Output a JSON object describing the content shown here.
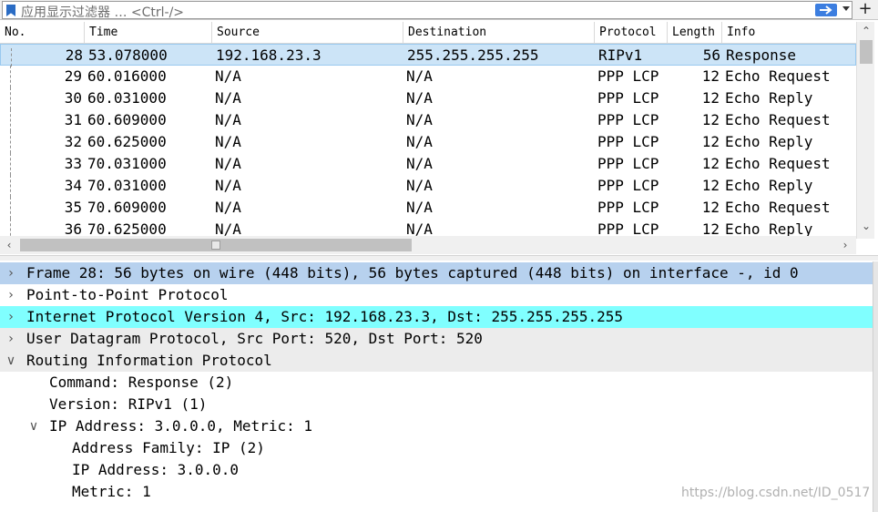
{
  "filter": {
    "placeholder": "应用显示过滤器 … <Ctrl-/>"
  },
  "columns": [
    "No.",
    "Time",
    "Source",
    "Destination",
    "Protocol",
    "Length",
    "Info"
  ],
  "packets": [
    {
      "no": "28",
      "time": "53.078000",
      "source": "192.168.23.3",
      "destination": "255.255.255.255",
      "protocol": "RIPv1",
      "length": "56",
      "info": "Response",
      "selected": true
    },
    {
      "no": "29",
      "time": "60.016000",
      "source": "N/A",
      "destination": "N/A",
      "protocol": "PPP LCP",
      "length": "12",
      "info": "Echo Request"
    },
    {
      "no": "30",
      "time": "60.031000",
      "source": "N/A",
      "destination": "N/A",
      "protocol": "PPP LCP",
      "length": "12",
      "info": "Echo Reply"
    },
    {
      "no": "31",
      "time": "60.609000",
      "source": "N/A",
      "destination": "N/A",
      "protocol": "PPP LCP",
      "length": "12",
      "info": "Echo Request"
    },
    {
      "no": "32",
      "time": "60.625000",
      "source": "N/A",
      "destination": "N/A",
      "protocol": "PPP LCP",
      "length": "12",
      "info": "Echo Reply"
    },
    {
      "no": "33",
      "time": "70.031000",
      "source": "N/A",
      "destination": "N/A",
      "protocol": "PPP LCP",
      "length": "12",
      "info": "Echo Request"
    },
    {
      "no": "34",
      "time": "70.031000",
      "source": "N/A",
      "destination": "N/A",
      "protocol": "PPP LCP",
      "length": "12",
      "info": "Echo Reply"
    },
    {
      "no": "35",
      "time": "70.609000",
      "source": "N/A",
      "destination": "N/A",
      "protocol": "PPP LCP",
      "length": "12",
      "info": "Echo Request"
    },
    {
      "no": "36",
      "time": "70.625000",
      "source": "N/A",
      "destination": "N/A",
      "protocol": "PPP LCP",
      "length": "12",
      "info": "Echo Reply"
    }
  ],
  "details": [
    {
      "text": "Frame 28: 56 bytes on wire (448 bits), 56 bytes captured (448 bits) on interface -, id 0",
      "level": 0,
      "expander": "collapsed",
      "bg": "blue"
    },
    {
      "text": "Point-to-Point Protocol",
      "level": 0,
      "expander": "collapsed",
      "bg": ""
    },
    {
      "text": "Internet Protocol Version 4, Src: 192.168.23.3, Dst: 255.255.255.255",
      "level": 0,
      "expander": "collapsed",
      "bg": "cyan"
    },
    {
      "text": "User Datagram Protocol, Src Port: 520, Dst Port: 520",
      "level": 0,
      "expander": "collapsed",
      "bg": "grey"
    },
    {
      "text": "Routing Information Protocol",
      "level": 0,
      "expander": "expanded",
      "bg": "grey"
    },
    {
      "text": "Command: Response (2)",
      "level": 1,
      "expander": "",
      "bg": ""
    },
    {
      "text": "Version: RIPv1 (1)",
      "level": 1,
      "expander": "",
      "bg": ""
    },
    {
      "text": "IP Address: 3.0.0.0, Metric: 1",
      "level": 1,
      "expander": "expanded",
      "bg": ""
    },
    {
      "text": "Address Family: IP (2)",
      "level": 2,
      "expander": "",
      "bg": ""
    },
    {
      "text": "IP Address: 3.0.0.0",
      "level": 2,
      "expander": "",
      "bg": ""
    },
    {
      "text": "Metric: 1",
      "level": 2,
      "expander": "",
      "bg": ""
    }
  ],
  "watermark": "https://blog.csdn.net/ID_0517",
  "icons": {
    "bookmark": "bookmark-icon",
    "apply": "arrow-right-icon",
    "dropdown": "chevron-down-icon",
    "add": "plus-icon"
  }
}
